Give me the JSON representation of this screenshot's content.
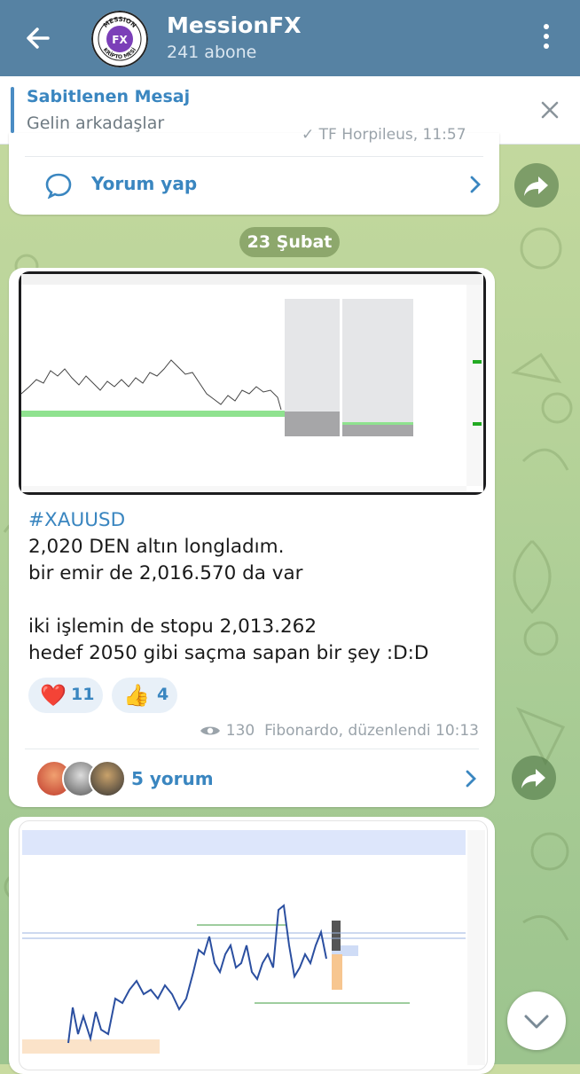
{
  "header": {
    "title": "MessionFX",
    "subtitle": "241 abone",
    "avatar_ring_top": "MESSION",
    "avatar_ring_bottom": "KRİPTO MESİ",
    "avatar_badge": "FX"
  },
  "pinned": {
    "title": "Sabitlenen Mesaj",
    "text": "Gelin arkadaşlar"
  },
  "prev_message": {
    "cut_text": "✓ TF Horpileus, 11:57",
    "comment_label": "Yorum yap"
  },
  "date_separator": "23 Şubat",
  "message": {
    "lines": [
      "#XAUUSD",
      "2,020 DEN altın longladım.",
      "bir emir de 2,016.570 da var",
      "",
      "iki işlemin de stopu 2,013.262",
      "hedef 2050 gibi saçma sapan bir şey :D:D"
    ],
    "reactions": [
      {
        "emoji": "❤️",
        "count": "11"
      },
      {
        "emoji": "👍",
        "count": "4"
      }
    ],
    "views": "130",
    "footer": "Fibonardo, düzenlendi 10:13",
    "comments_label": "5 yorum"
  },
  "icons": {
    "back": "back-arrow-icon",
    "menu": "more-vertical-icon",
    "close": "close-icon",
    "comment": "comment-bubble-icon",
    "chevron": "chevron-right-icon",
    "share": "share-forward-icon",
    "eye": "eye-icon",
    "scroll": "chevron-down-icon"
  },
  "colors": {
    "header": "#5682a3",
    "accent": "#3a86c0",
    "heart": "#e53935"
  }
}
